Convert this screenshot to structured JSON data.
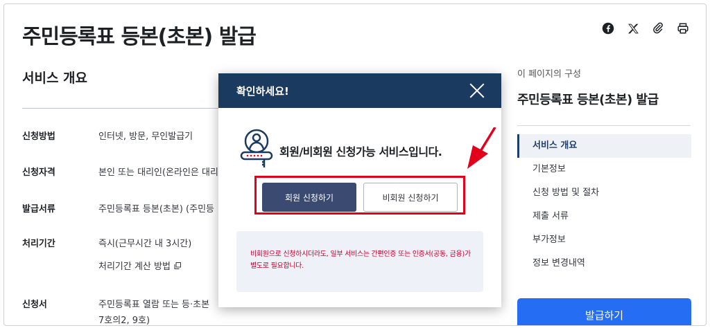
{
  "page": {
    "title": "주민등록표 등본(초본) 발급"
  },
  "share_icons": [
    "facebook-icon",
    "x-icon",
    "link-icon",
    "print-icon"
  ],
  "overview": {
    "title": "서비스 개요",
    "rows": [
      {
        "key": "신청방법",
        "value": "인터넷, 방문, 무인발급기"
      },
      {
        "key": "신청자격",
        "value": "본인 또는 대리인(온라인은 대리"
      },
      {
        "key": "발급서류",
        "value": "주민등록표 등본(초본) (주민등"
      },
      {
        "key": "처리기간",
        "value": "즉시(근무시간 내 3시간)"
      },
      {
        "key": "신청서",
        "value": "주민등록표 열람 또는 등·초본"
      }
    ],
    "calc_link": "처리기간 계산 방법",
    "applicant_extra": "7호의2, 9호)"
  },
  "toc": {
    "caption": "이 페이지의 구성",
    "title": "주민등록표 등본(초본) 발급",
    "items": [
      "서비스 개요",
      "기본정보",
      "신청 방법 및 절차",
      "제출 서류",
      "부가정보",
      "정보 변경내역"
    ],
    "active_index": 0,
    "issue_button": "발급하기"
  },
  "modal": {
    "title": "확인하세요!",
    "message": "회원/비회원 신청가능 서비스입니다.",
    "member_button": "회원 신청하기",
    "guest_button": "비회원 신청하기",
    "notice": "비회원으로 신청하시더라도, 일부 서비스는 간편인증 또는 인증서(공동, 금융)가 별도로 필요합니다."
  },
  "colors": {
    "modal_header": "#1b3a5f",
    "member_button": "#3a4a70",
    "highlight": "#e3001b",
    "issue_button": "#256ef4",
    "notice_text": "#c4002b"
  }
}
